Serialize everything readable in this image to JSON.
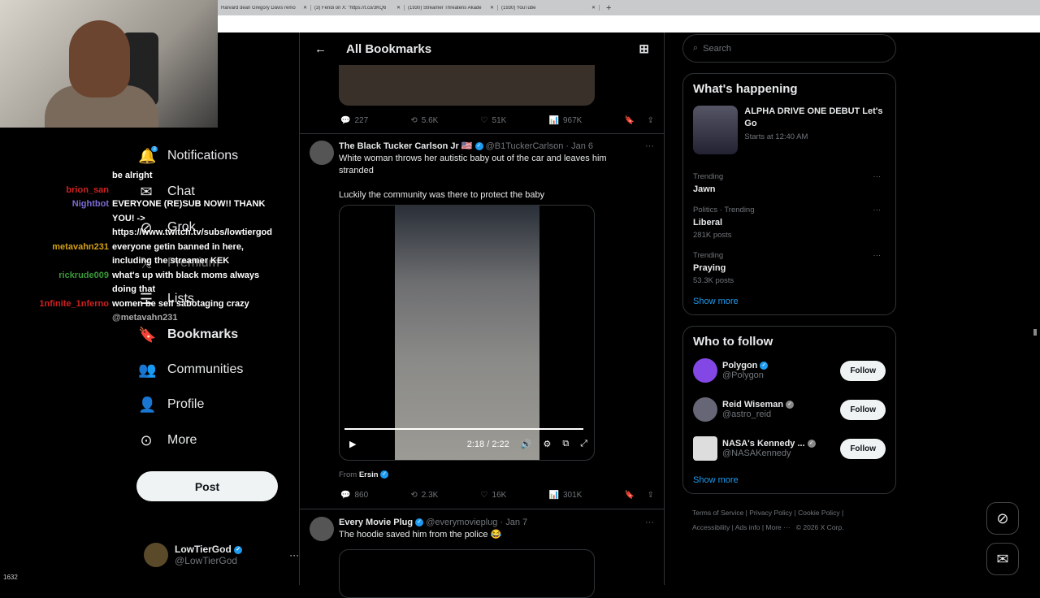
{
  "browser": {
    "tabs": [
      {
        "title": "Harvard dean Gregory Davis remo"
      },
      {
        "title": "(3) Fendi on X: \"https://t.co/3KQ6"
      },
      {
        "title": "(1930) Streamer Threatens Akade"
      },
      {
        "title": "(1930) YouTube"
      }
    ]
  },
  "nav": {
    "items": [
      {
        "label": "Notifications",
        "icon": "bell-icon"
      },
      {
        "label": "Chat",
        "icon": "mail-icon"
      },
      {
        "label": "Grok",
        "icon": "grok-icon"
      },
      {
        "label": "Premium",
        "icon": "x-icon"
      },
      {
        "label": "Lists",
        "icon": "list-icon"
      },
      {
        "label": "Bookmarks",
        "icon": "bookmark-icon"
      },
      {
        "label": "Communities",
        "icon": "people-icon"
      },
      {
        "label": "Profile",
        "icon": "person-icon"
      },
      {
        "label": "More",
        "icon": "more-circle-icon"
      }
    ],
    "notif_badge": "3",
    "post_label": "Post",
    "user": {
      "name": "LowTierGod",
      "handle": "@LowTierGod"
    }
  },
  "chat": [
    {
      "user": "",
      "msg": "be alright",
      "color": "#c33"
    },
    {
      "user": "brion_san",
      "msg": "",
      "color": "#d02020"
    },
    {
      "user": "Nightbot",
      "msg": "EVERYONE (RE)SUB NOW!! THANK YOU! -> https://www.twitch.tv/subs/lowtiergod",
      "color": "#7a6cd4"
    },
    {
      "user": "metavahn231",
      "msg": "everyone getin banned in here, including the streamer KEK",
      "color": "#d4a017"
    },
    {
      "user": "rickrude009",
      "msg": "what's up with black moms always doing that",
      "color": "#3a9a3a"
    },
    {
      "user": "1nfinite_1nferno",
      "msg": "women be self sabotaging crazy",
      "color": "#d02020"
    },
    {
      "user": "",
      "msg": "@metavahn231",
      "color": "#2a2adf"
    }
  ],
  "viewer_count": "1632",
  "center": {
    "title": "All Bookmarks",
    "tweets": [
      {
        "stats": {
          "replies": "227",
          "reposts": "5.6K",
          "likes": "51K",
          "views": "967K"
        }
      },
      {
        "name": "The Black Tucker Carlson Jr 🇺🇸",
        "handle": "@B1TuckerCarlson",
        "date": "Jan 6",
        "text": "White woman throws her autistic baby out of the car and leaves him stranded",
        "text2": "Luckily the community was there to protect the baby",
        "video_time": "2:18 / 2:22",
        "video_progress": 0.97,
        "from_label": "From",
        "from_name": "Ersin",
        "stats": {
          "replies": "860",
          "reposts": "2.3K",
          "likes": "16K",
          "views": "301K"
        }
      },
      {
        "name": "Every Movie Plug",
        "handle": "@everymovieplug",
        "date": "Jan 7",
        "text": "The hoodie saved him from the police 😂"
      }
    ]
  },
  "right": {
    "search_placeholder": "Search",
    "whats_happening": "What's happening",
    "event": {
      "title": "ALPHA DRIVE ONE DEBUT Let's Go",
      "sub": "Starts at 12:40 AM"
    },
    "trends": [
      {
        "context": "Trending",
        "name": "Jawn",
        "posts": ""
      },
      {
        "context": "Politics · Trending",
        "name": "Liberal",
        "posts": "281K posts"
      },
      {
        "context": "Trending",
        "name": "Praying",
        "posts": "53.3K posts"
      }
    ],
    "show_more": "Show more",
    "who_to_follow": "Who to follow",
    "follow": [
      {
        "name": "Polygon",
        "handle": "@Polygon",
        "color": "#8247e5"
      },
      {
        "name": "Reid Wiseman",
        "handle": "@astro_reid",
        "color": "#556"
      },
      {
        "name": "NASA's Kennedy ...",
        "handle": "@NASAKennedy",
        "color": "#ddd"
      }
    ],
    "follow_label": "Follow",
    "footer": [
      "Terms of Service",
      "Privacy Policy",
      "Cookie Policy",
      "Accessibility",
      "Ads info",
      "More ···",
      "© 2026 X Corp."
    ]
  }
}
